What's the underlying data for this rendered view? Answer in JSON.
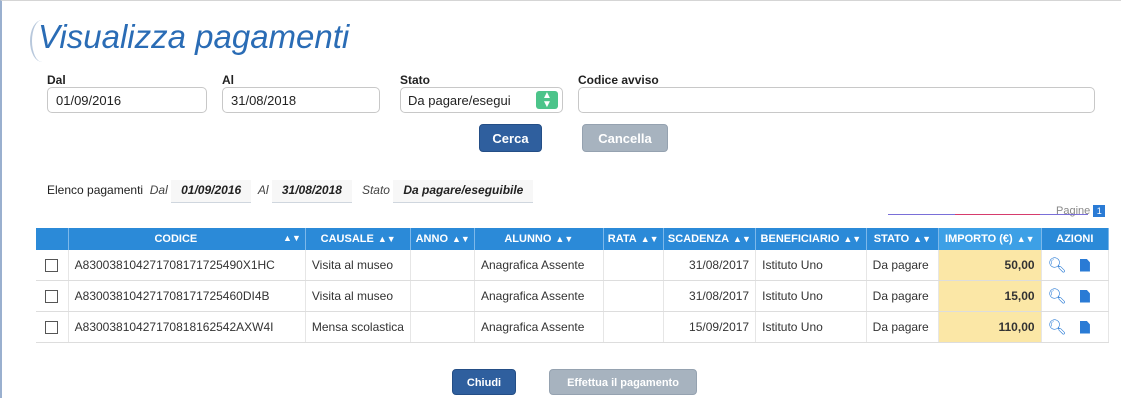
{
  "title": "Visualizza pagamenti",
  "filters": {
    "dal_label": "Dal",
    "dal_value": "01/09/2016",
    "al_label": "Al",
    "al_value": "31/08/2018",
    "stato_label": "Stato",
    "stato_value": "Da pagare/esegui",
    "codice_label": "Codice avviso",
    "codice_value": ""
  },
  "buttons": {
    "cerca": "Cerca",
    "cancella": "Cancella",
    "chiudi": "Chiudi",
    "effettua": "Effettua il pagamento"
  },
  "summary": {
    "label": "Elenco pagamenti",
    "dal_label": "Dal",
    "dal_value": "01/09/2016",
    "al_label": "Al",
    "al_value": "31/08/2018",
    "stato_label": "Stato",
    "stato_value": "Da pagare/eseguibile"
  },
  "pagine_label": "Pagine",
  "pagine_value": "1",
  "table": {
    "headers": [
      "",
      "CODICE",
      "CAUSALE",
      "ANNO",
      "ALUNNO",
      "RATA",
      "SCADENZA",
      "BENEFICIARIO",
      "STATO",
      "IMPORTO (€)",
      "AZIONI"
    ],
    "rows": [
      {
        "codice": "A830038104271708171725490X1HC",
        "causale": "Visita al museo",
        "anno": "",
        "alunno": "Anagrafica Assente",
        "rata": "",
        "scadenza": "31/08/2017",
        "beneficiario": "Istituto Uno",
        "stato": "Da pagare",
        "importo": "50,00"
      },
      {
        "codice": "A830038104271708171725460DI4B",
        "causale": "Visita al museo",
        "anno": "",
        "alunno": "Anagrafica Assente",
        "rata": "",
        "scadenza": "31/08/2017",
        "beneficiario": "Istituto Uno",
        "stato": "Da pagare",
        "importo": "15,00"
      },
      {
        "codice": "A83003810427170818162542AXW4I",
        "causale": "Mensa scolastica",
        "anno": "",
        "alunno": "Anagrafica Assente",
        "rata": "",
        "scadenza": "15/09/2017",
        "beneficiario": "Istituto Uno",
        "stato": "Da pagare",
        "importo": "110,00"
      }
    ]
  },
  "icons": {
    "search": "search-icon",
    "document": "document-icon",
    "sort": "sort-icon"
  },
  "colors": {
    "header_blue": "#2b8ad8",
    "title_blue": "#2a6cb5",
    "amount_highlight": "#fbe7a6",
    "primary_button": "#2f5f9e",
    "disabled_button": "#a7b3bf",
    "select_arrow": "#4cc48a",
    "highlight_box": "#d62828"
  }
}
